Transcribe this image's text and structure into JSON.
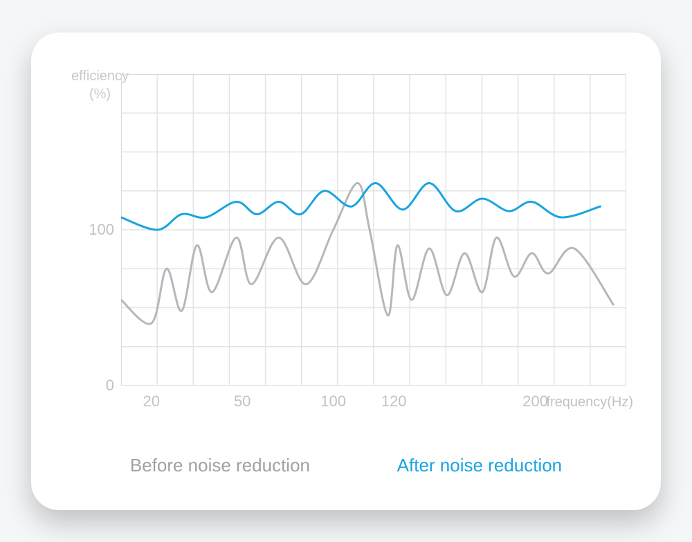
{
  "chart_data": {
    "type": "line",
    "title": "",
    "ylabel": "efficiency\n(%)",
    "xlabel": "frequency(Hz)",
    "y_ticks": [
      0,
      100
    ],
    "x_ticks": [
      20,
      50,
      100,
      120,
      200
    ],
    "ylim": [
      0,
      200
    ],
    "legend_position": "bottom",
    "series": [
      {
        "name": "Before noise reduction",
        "color": "#b4b8bc",
        "x": [
          15,
          20,
          25,
          30,
          35,
          40,
          48,
          55,
          70,
          85,
          100,
          108,
          112,
          118,
          122,
          130,
          140,
          150,
          160,
          170,
          178,
          188,
          198,
          205,
          215,
          230
        ],
        "values": [
          55,
          40,
          75,
          48,
          90,
          60,
          95,
          65,
          95,
          65,
          100,
          130,
          100,
          45,
          90,
          55,
          88,
          58,
          85,
          60,
          95,
          70,
          85,
          72,
          88,
          52
        ]
      },
      {
        "name": "After noise reduction",
        "color": "#1aa4e0",
        "x": [
          15,
          22,
          30,
          38,
          48,
          58,
          70,
          82,
          95,
          106,
          114,
          125,
          140,
          155,
          170,
          185,
          198,
          210,
          225
        ],
        "values": [
          108,
          100,
          110,
          108,
          118,
          110,
          118,
          110,
          125,
          115,
          130,
          113,
          130,
          112,
          120,
          112,
          118,
          108,
          115
        ]
      }
    ]
  },
  "legend": {
    "before": "Before noise reduction",
    "after": "After noise reduction"
  },
  "axis": {
    "ylabel_line1": "efficiency",
    "ylabel_line2": "(%)",
    "xlabel": "frequency(Hz)",
    "ytick_100": "100",
    "ytick_0": "0",
    "xtick_20": "20",
    "xtick_50": "50",
    "xtick_100": "100",
    "xtick_120": "120",
    "xtick_200": "200"
  }
}
